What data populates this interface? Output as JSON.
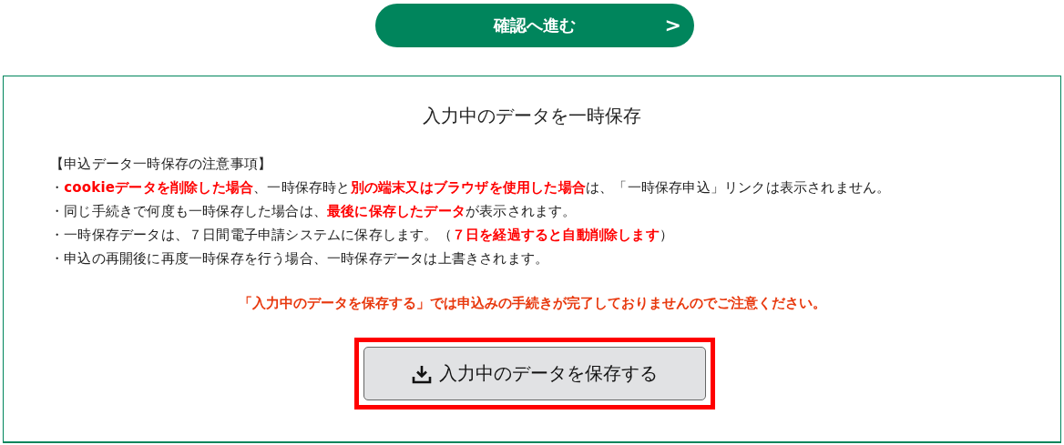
{
  "next_button": {
    "label": "確認へ進む",
    "arrow": ">"
  },
  "panel": {
    "title": "入力中のデータを一時保存",
    "notes_heading": "【申込データ一時保存の注意事項】",
    "notes": [
      "・**cookieデータを削除した場合**、一時保存時と**別の端末又はブラウザを使用した場合**は、「一時保存申込」リンクは表示されません。",
      "・同じ手続きで何度も一時保存した場合は、**最後に保存したデータ**が表示されます。",
      "・一時保存データは、７日間電子申請システムに保存します。（**７日を経過すると自動削除します**）",
      "・申込の再開後に再度一時保存を行う場合、一時保存データは上書きされます。"
    ],
    "warning": "「入力中のデータを保存する」では申込みの手続きが完了しておりませんのでご注意ください。",
    "save_button": {
      "label": "入力中のデータを保存する",
      "highlighted": true
    }
  }
}
